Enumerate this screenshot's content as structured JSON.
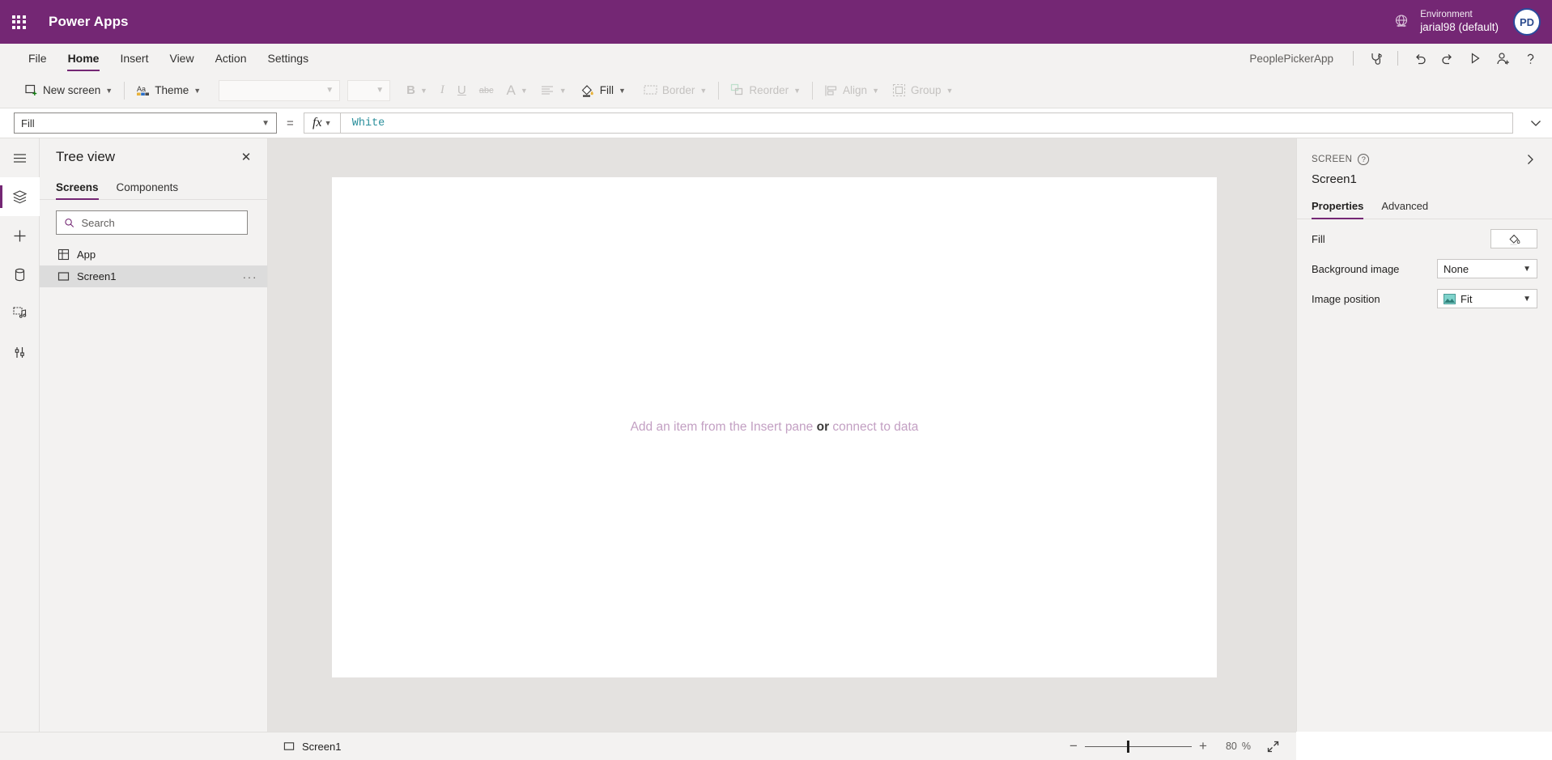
{
  "topbar": {
    "waffle_label": "app-launcher",
    "brand": "Power Apps",
    "environment_label": "Environment",
    "environment_value": "jarial98 (default)",
    "avatar_initials": "PD",
    "bar_color": "#742774"
  },
  "menubar": {
    "items": [
      {
        "label": "File",
        "active": false
      },
      {
        "label": "Home",
        "active": true
      },
      {
        "label": "Insert",
        "active": false
      },
      {
        "label": "View",
        "active": false
      },
      {
        "label": "Action",
        "active": false
      },
      {
        "label": "Settings",
        "active": false
      }
    ],
    "app_name": "PeoplePickerApp",
    "icons": [
      "app-checker-icon",
      "undo-icon",
      "redo-icon",
      "play-preview-icon",
      "share-icon",
      "help-icon"
    ]
  },
  "ribbon": {
    "new_screen": "New screen",
    "theme": "Theme",
    "font_family_value": "",
    "font_size_value": "",
    "bold": "B",
    "italic": "I",
    "underline": "U",
    "strikethrough": "abc",
    "font_color": "A",
    "align": "align",
    "fill": "Fill",
    "border": "Border",
    "reorder": "Reorder",
    "align_label": "Align",
    "group": "Group"
  },
  "formula_bar": {
    "property_selected": "Fill",
    "equals": "=",
    "fx": "fx",
    "formula_value": "White"
  },
  "rail": {
    "items": [
      {
        "name": "hamburger-menu-icon",
        "selected": false
      },
      {
        "name": "tree-view-icon",
        "selected": true
      },
      {
        "name": "insert-add-icon",
        "selected": false
      },
      {
        "name": "data-sources-icon",
        "selected": false
      },
      {
        "name": "media-icon",
        "selected": false
      },
      {
        "name": "advanced-tools-icon",
        "selected": false
      }
    ]
  },
  "tree_view": {
    "title": "Tree view",
    "close": "✕",
    "tabs": [
      {
        "label": "Screens",
        "active": true
      },
      {
        "label": "Components",
        "active": false
      }
    ],
    "search_placeholder": "Search",
    "search_value": "",
    "rows": [
      {
        "label": "App",
        "icon": "app-icon",
        "selected": false,
        "has_menu": false
      },
      {
        "label": "Screen1",
        "icon": "screen-icon",
        "selected": true,
        "has_menu": true
      }
    ],
    "row_menu": "···"
  },
  "canvas": {
    "message_prefix": "Add an item from the Insert pane",
    "message_or": "or",
    "message_link": "connect to data",
    "background": "#e4e2e0",
    "screen_fill": "#ffffff"
  },
  "properties": {
    "kicker": "SCREEN",
    "help": "?",
    "selected_name": "Screen1",
    "tabs": [
      {
        "label": "Properties",
        "active": true
      },
      {
        "label": "Advanced",
        "active": false
      }
    ],
    "rows": [
      {
        "label": "Fill",
        "control": "swatch",
        "value": "",
        "swatch_color": "#ffffff"
      },
      {
        "label": "Background image",
        "control": "dropdown",
        "value": "None"
      },
      {
        "label": "Image position",
        "control": "dropdown-icon",
        "value": "Fit"
      }
    ]
  },
  "statusbar": {
    "screen_label": "Screen1",
    "zoom_out": "−",
    "zoom_in": "+",
    "zoom_value": "80",
    "zoom_unit": "%",
    "fit_label": "fit-to-screen"
  }
}
